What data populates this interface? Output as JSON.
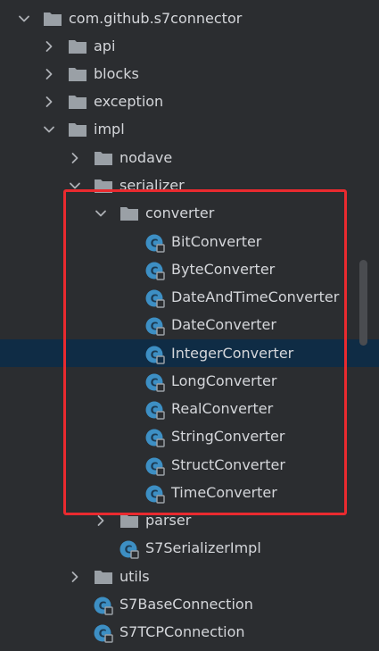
{
  "tree": {
    "items": [
      {
        "label": "com.github.s7connector",
        "kind": "folder",
        "expanded": true
      },
      {
        "label": "api",
        "kind": "folder",
        "expanded": false
      },
      {
        "label": "blocks",
        "kind": "folder",
        "expanded": false
      },
      {
        "label": "exception",
        "kind": "folder",
        "expanded": false
      },
      {
        "label": "impl",
        "kind": "folder",
        "expanded": true
      },
      {
        "label": "nodave",
        "kind": "folder",
        "expanded": false
      },
      {
        "label": "serializer",
        "kind": "folder",
        "expanded": true
      },
      {
        "label": "converter",
        "kind": "folder",
        "expanded": true
      },
      {
        "label": "BitConverter",
        "kind": "class"
      },
      {
        "label": "ByteConverter",
        "kind": "class"
      },
      {
        "label": "DateAndTimeConverter",
        "kind": "class"
      },
      {
        "label": "DateConverter",
        "kind": "class"
      },
      {
        "label": "IntegerConverter",
        "kind": "class",
        "selected": true
      },
      {
        "label": "LongConverter",
        "kind": "class"
      },
      {
        "label": "RealConverter",
        "kind": "class"
      },
      {
        "label": "StringConverter",
        "kind": "class"
      },
      {
        "label": "StructConverter",
        "kind": "class"
      },
      {
        "label": "TimeConverter",
        "kind": "class"
      },
      {
        "label": "parser",
        "kind": "folder",
        "expanded": false
      },
      {
        "label": "S7SerializerImpl",
        "kind": "class"
      },
      {
        "label": "utils",
        "kind": "folder",
        "expanded": false
      },
      {
        "label": "S7BaseConnection",
        "kind": "class"
      },
      {
        "label": "S7TCPConnection",
        "kind": "class"
      }
    ]
  },
  "colors": {
    "background": "#2b2d30",
    "selection": "#0f2c45",
    "text": "#d4d6da",
    "folder_icon": "#9aa0a6",
    "class_icon": "#3d8fc4",
    "highlight_border": "#ea2a2f"
  },
  "icons": {
    "expanded": "chevron-down-icon",
    "collapsed": "chevron-right-icon",
    "folder": "folder-icon",
    "class": "java-class-icon"
  }
}
